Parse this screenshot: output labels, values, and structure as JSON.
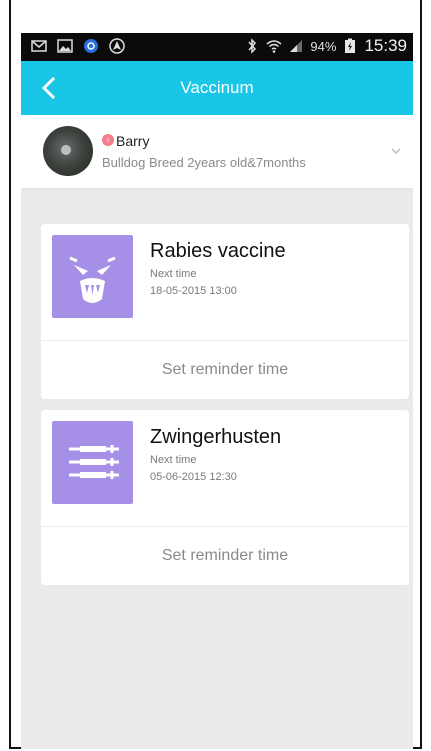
{
  "status_bar": {
    "battery": "94%",
    "time": "15:39",
    "icons": [
      "mail-icon",
      "image-icon",
      "app-icon",
      "navigation-icon",
      "bluetooth-icon",
      "wifi-icon",
      "signal-icon",
      "battery-icon"
    ]
  },
  "app_bar": {
    "title": "Vaccinum",
    "back_icon": "chevron-left-icon",
    "color": "#19c6e6"
  },
  "pet": {
    "name": "Barry",
    "description": "Bulldog Breed 2years old&7months",
    "gender_icon": "female-icon",
    "expand_icon": "chevron-down-icon"
  },
  "vaccines": [
    {
      "name": "Rabies vaccine",
      "next_label": "Next time",
      "next_date": "18-05-2015 13:00",
      "icon": "beast-face-icon",
      "reminder_label": "Set reminder time"
    },
    {
      "name": "Zwingerhusten",
      "next_label": "Next time",
      "next_date": "05-06-2015 12:30",
      "icon": "syringes-icon",
      "reminder_label": "Set reminder time"
    }
  ],
  "colors": {
    "accent": "#19c6e6",
    "tile": "#a68fe6",
    "background": "#eaeaea"
  }
}
